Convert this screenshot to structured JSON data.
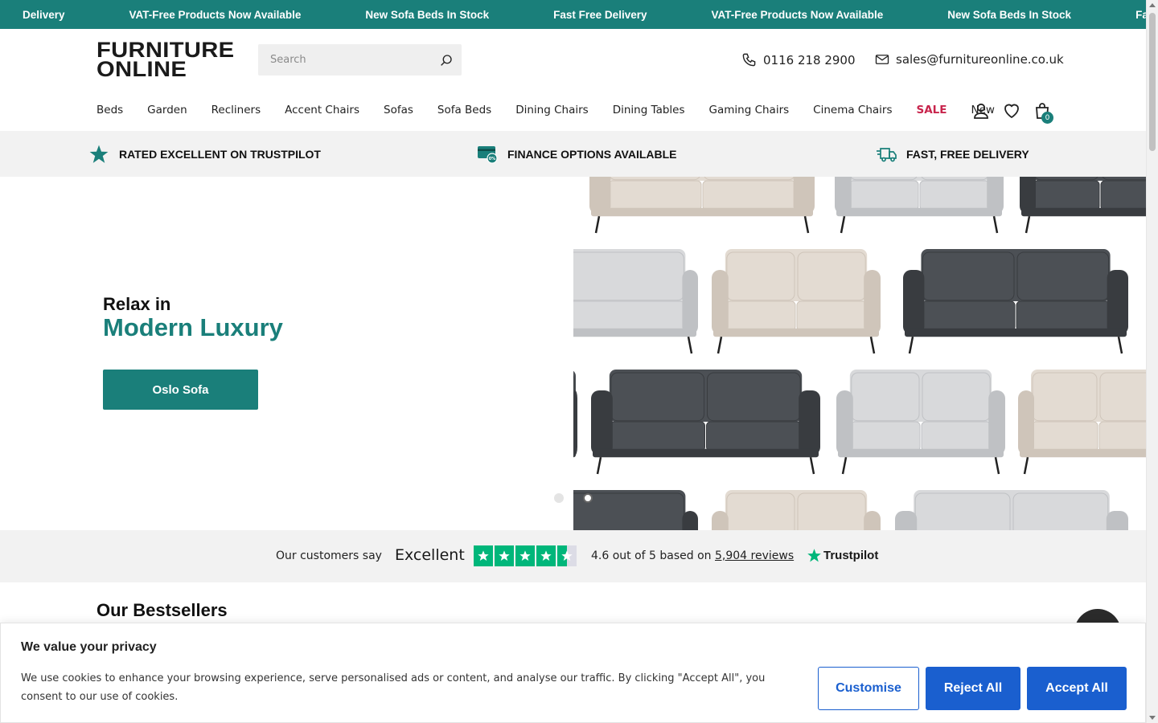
{
  "announcement": {
    "messages": [
      "Delivery",
      "VAT-Free Products Now Available",
      "New Sofa Beds In Stock",
      "Fast Free Delivery",
      "VAT-Free Products Now Available",
      "New Sofa Beds In Stock",
      "Fast Free Delivery"
    ]
  },
  "brand": {
    "line1": "FURNITURE",
    "line2": "ONLINE"
  },
  "search": {
    "placeholder": "Search"
  },
  "contact": {
    "phone": "0116 218 2900",
    "email": "sales@furnitureonline.co.uk"
  },
  "nav": {
    "items": [
      "Beds",
      "Garden",
      "Recliners",
      "Accent Chairs",
      "Sofas",
      "Sofa Beds",
      "Dining Chairs",
      "Dining Tables",
      "Gaming Chairs",
      "Cinema Chairs",
      "SALE",
      "New"
    ],
    "cart_count": "0"
  },
  "trust_bar": {
    "trustpilot": "RATED EXCELLENT ON TRUSTPILOT",
    "finance": "FINANCE OPTIONS AVAILABLE",
    "delivery": "FAST, FREE DELIVERY"
  },
  "hero": {
    "eyebrow": "Relax in",
    "headline": "Modern Luxury",
    "cta": "Oslo Sofa",
    "active_slide": 2,
    "slide_count": 2
  },
  "trustpilot": {
    "customers_say": "Our customers say",
    "rating_word": "Excellent",
    "score_prefix": "4.6 out of 5 based on",
    "reviews": "5,904 reviews",
    "brand": "Trustpilot",
    "stars": 4.5
  },
  "section": {
    "bestsellers": "Our Bestsellers"
  },
  "cookie": {
    "title": "We value your privacy",
    "text": "We use cookies to enhance your browsing experience, serve personalised ads or content, and analyse our traffic. By clicking \"Accept All\", you consent to our use of cookies.",
    "customise": "Customise",
    "reject": "Reject All",
    "accept": "Accept All"
  },
  "colors": {
    "brand_teal": "#1a7f7a",
    "sale_red": "#c8244c",
    "trustpilot_green": "#00b67a",
    "cookie_blue": "#1a5fcf"
  }
}
